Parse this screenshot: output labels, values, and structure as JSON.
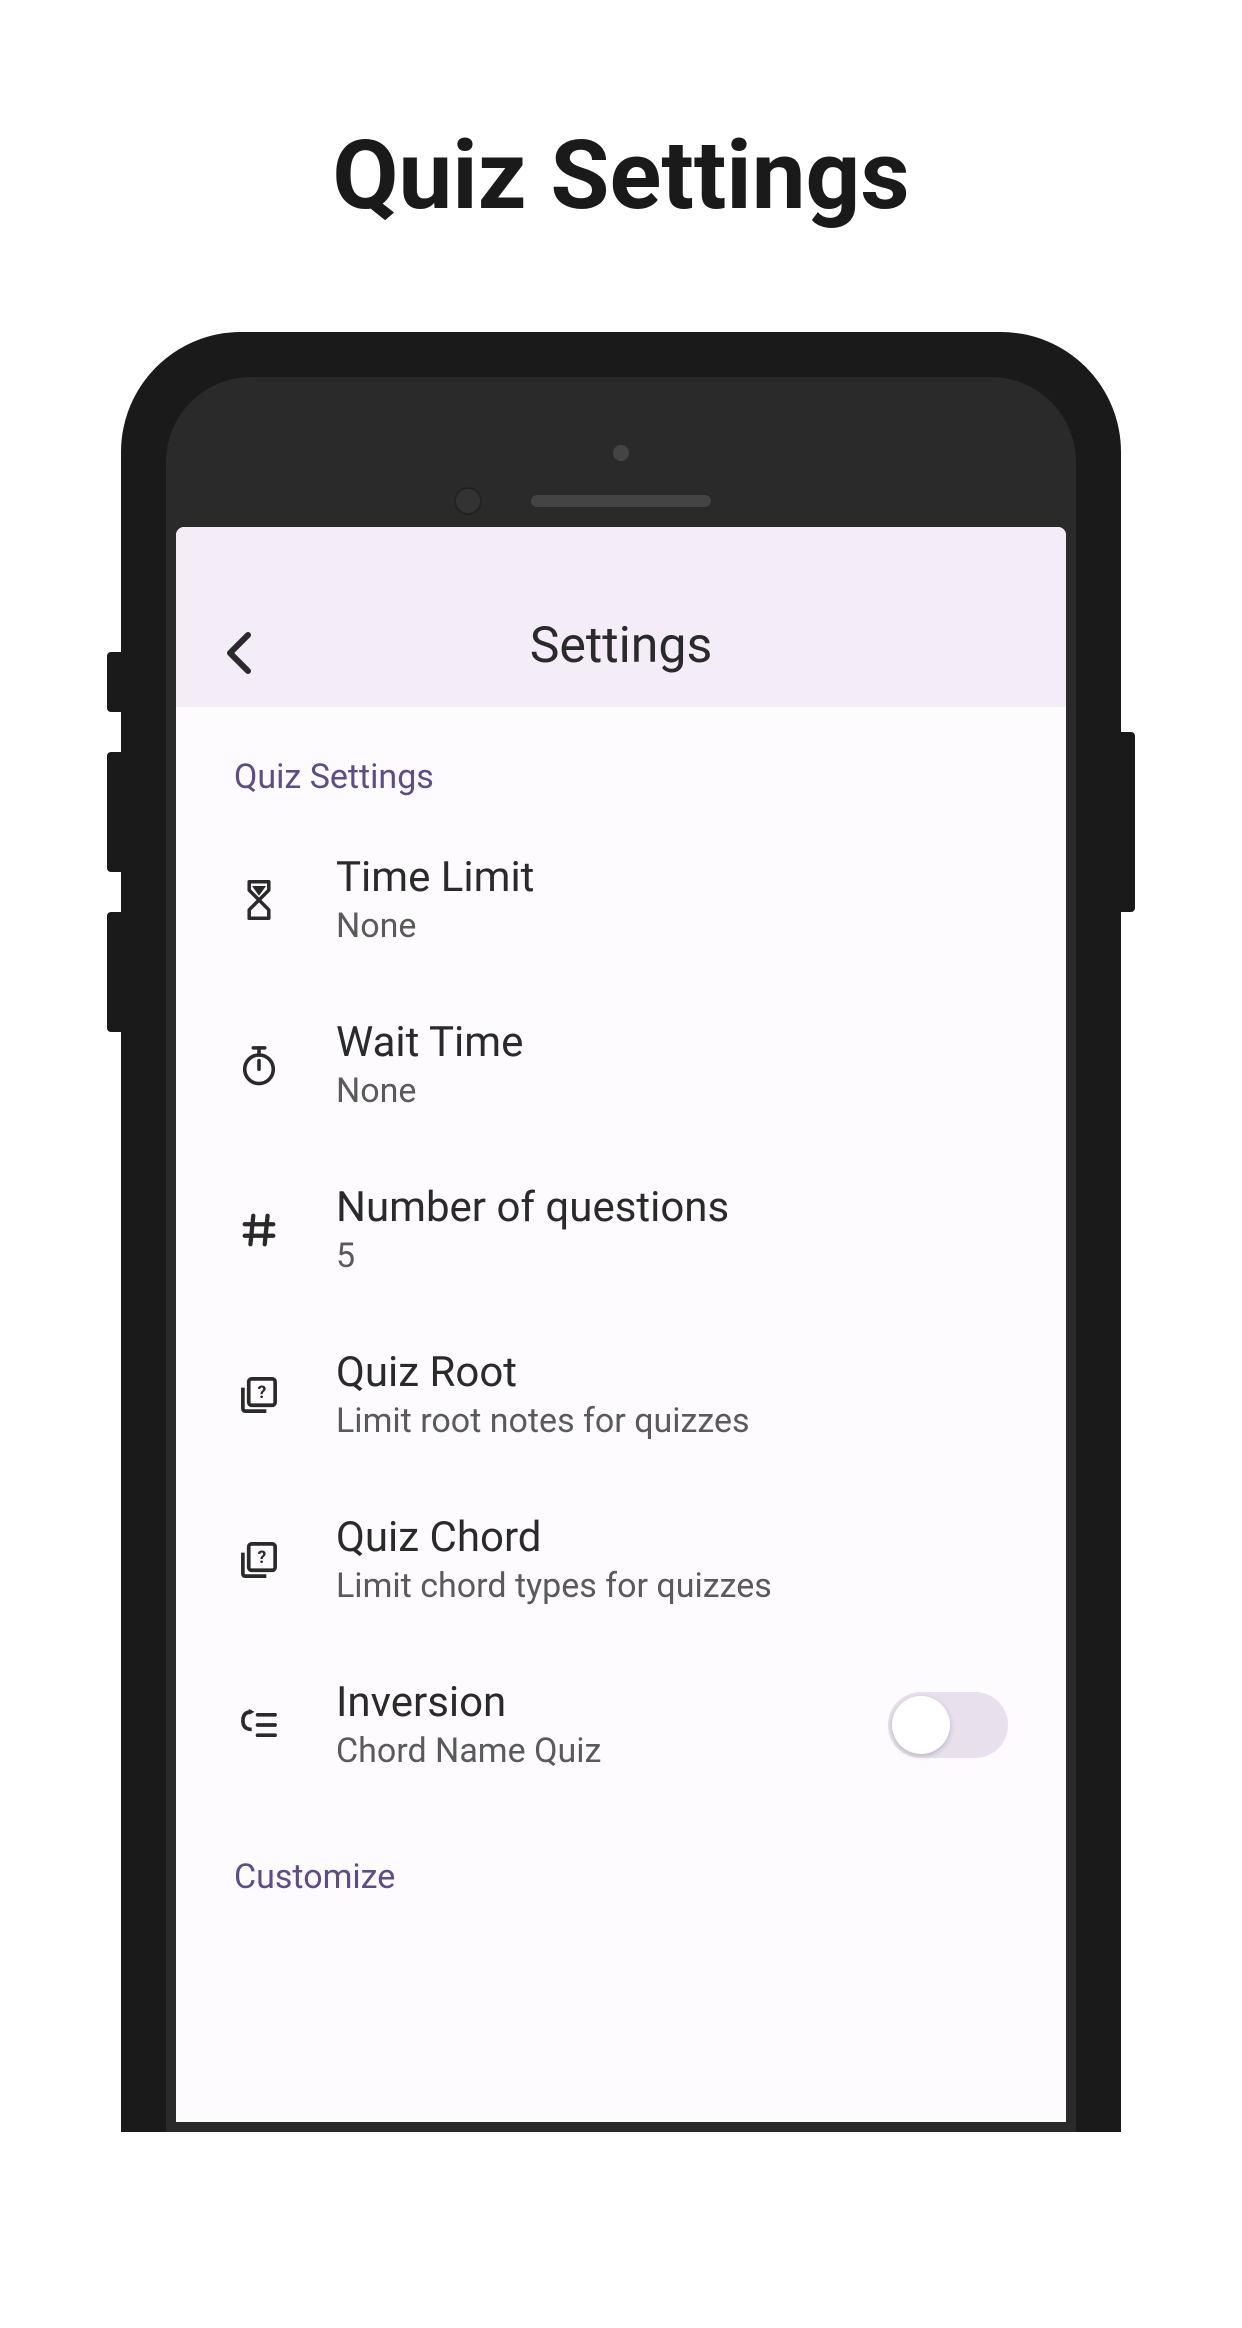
{
  "page_title": "Quiz Settings",
  "nav": {
    "title": "Settings"
  },
  "sections": {
    "quiz_settings": {
      "header": "Quiz Settings",
      "items": [
        {
          "icon": "hourglass-icon",
          "title": "Time Limit",
          "subtitle": "None"
        },
        {
          "icon": "timer-icon",
          "title": "Wait Time",
          "subtitle": "None"
        },
        {
          "icon": "hash-icon",
          "title": "Number of questions",
          "subtitle": "5"
        },
        {
          "icon": "quiz-card-icon",
          "title": "Quiz Root",
          "subtitle": "Limit root notes for quizzes"
        },
        {
          "icon": "quiz-card-icon",
          "title": "Quiz Chord",
          "subtitle": "Limit chord types for quizzes"
        },
        {
          "icon": "inversion-icon",
          "title": "Inversion",
          "subtitle": "Chord Name Quiz",
          "toggle": false
        }
      ]
    },
    "customize": {
      "header": "Customize"
    }
  }
}
